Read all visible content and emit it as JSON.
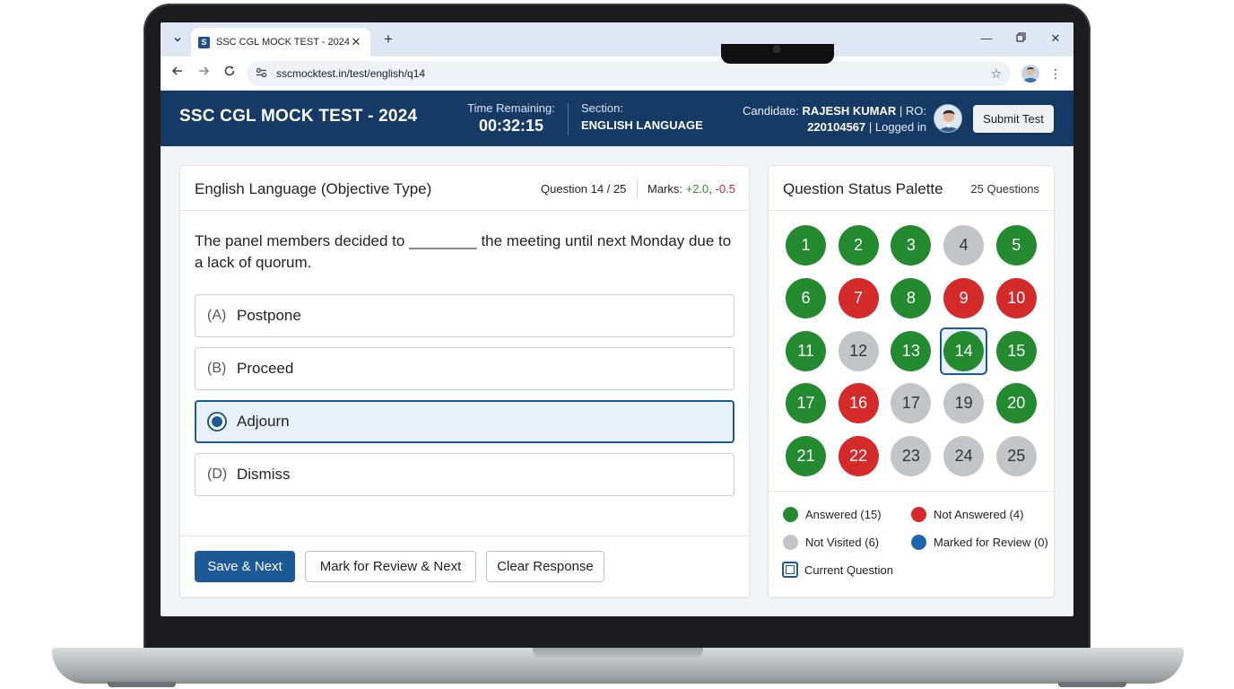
{
  "browser": {
    "tab_title": "SSC CGL MOCK TEST - 2024",
    "favicon_letter": "S",
    "url": "sscmocktest.in/test/english/q14"
  },
  "header": {
    "title": "SSC CGL MOCK TEST - 2024",
    "time_label": "Time Remaining:",
    "time_value": "00:32:15",
    "section_label": "Section:",
    "section_value": "ENGLISH LANGUAGE",
    "candidate_prefix": "Candidate:",
    "candidate_name": "RAJESH KUMAR",
    "roll_prefix": "| RO:",
    "roll_number": "220104567",
    "login_status": "| Logged in",
    "submit_label": "Submit Test"
  },
  "question": {
    "subject": "English Language (Objective Type)",
    "number_text": "Question 14 / 25",
    "marks_label": "Marks:",
    "marks_positive": "+2.0",
    "marks_separator": ",",
    "marks_negative": "-0.5",
    "text": "The panel members decided to ________ the meeting until next Monday due to a lack of quorum.",
    "options": [
      {
        "letter": "(A)",
        "text": "Postpone",
        "selected": false
      },
      {
        "letter": "(B)",
        "text": "Proceed",
        "selected": false
      },
      {
        "letter": "(C)",
        "text": "Adjourn",
        "selected": true
      },
      {
        "letter": "(D)",
        "text": "Dismiss",
        "selected": false
      }
    ]
  },
  "actions": {
    "save_next": "Save & Next",
    "mark_review": "Mark for Review & Next",
    "clear": "Clear Response"
  },
  "palette": {
    "title": "Question Status Palette",
    "count_label": "25 Questions",
    "current": "14",
    "items": [
      {
        "label": "1",
        "status": "answered"
      },
      {
        "label": "2",
        "status": "answered"
      },
      {
        "label": "3",
        "status": "answered"
      },
      {
        "label": "4",
        "status": "not-visited"
      },
      {
        "label": "5",
        "status": "answered"
      },
      {
        "label": "6",
        "status": "answered"
      },
      {
        "label": "7",
        "status": "not-answered"
      },
      {
        "label": "8",
        "status": "answered"
      },
      {
        "label": "9",
        "status": "not-answered"
      },
      {
        "label": "10",
        "status": "not-answered"
      },
      {
        "label": "11",
        "status": "answered"
      },
      {
        "label": "12",
        "status": "not-visited"
      },
      {
        "label": "13",
        "status": "answered"
      },
      {
        "label": "14",
        "status": "answered"
      },
      {
        "label": "15",
        "status": "answered"
      },
      {
        "label": "17",
        "status": "answered"
      },
      {
        "label": "16",
        "status": "not-answered"
      },
      {
        "label": "17",
        "status": "not-visited"
      },
      {
        "label": "19",
        "status": "not-visited"
      },
      {
        "label": "20",
        "status": "answered"
      },
      {
        "label": "21",
        "status": "answered"
      },
      {
        "label": "22",
        "status": "not-answered"
      },
      {
        "label": "23",
        "status": "not-visited"
      },
      {
        "label": "24",
        "status": "not-visited"
      },
      {
        "label": "25",
        "status": "not-visited"
      }
    ],
    "legend": {
      "answered": "Answered (15)",
      "not_answered": "Not Answered (4)",
      "not_visited": "Not Visited (6)",
      "marked_review": "Marked for Review (0)",
      "current": "Current Question"
    }
  },
  "colors": {
    "header_bg": "#163a66",
    "primary": "#1d5a95",
    "answered": "#238a2f",
    "not_answered": "#d42a2a",
    "not_visited": "#c3c4c7",
    "marked_review": "#1e63b0"
  },
  "icons": {
    "tab_menu": "chevron-down-icon",
    "tab_close": "close-icon",
    "new_tab": "plus-icon",
    "back": "arrow-left-icon",
    "forward": "arrow-right-icon",
    "reload": "reload-icon",
    "site_info": "tune-icon",
    "bookmark": "star-icon",
    "menu": "kebab-icon"
  }
}
